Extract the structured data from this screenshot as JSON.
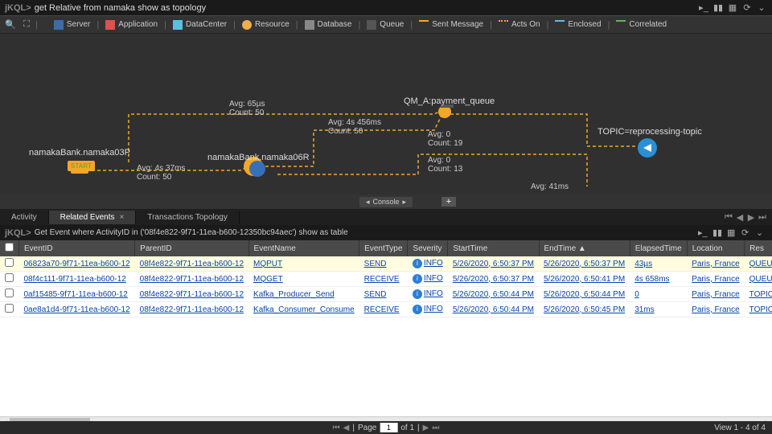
{
  "header": {
    "prompt": "jKQL>",
    "query": "get Relative from namaka show as topology"
  },
  "toolbar": {
    "search_icon": "🔍",
    "fullscreen_icon": "⛶",
    "legend": [
      {
        "icon": "server",
        "label": "Server"
      },
      {
        "icon": "app",
        "label": "Application"
      },
      {
        "icon": "dc",
        "label": "DataCenter"
      },
      {
        "icon": "res",
        "label": "Resource"
      },
      {
        "icon": "db",
        "label": "Database"
      },
      {
        "icon": "queue",
        "label": "Queue"
      },
      {
        "icon": "sent",
        "label": "Sent Message",
        "line": "dashed-orange"
      },
      {
        "icon": "acts",
        "label": "Acts On",
        "line": "dotted-orange"
      },
      {
        "icon": "encl",
        "label": "Enclosed",
        "line": "dashed-blue"
      },
      {
        "icon": "corr",
        "label": "Correlated",
        "line": "solid-green"
      }
    ]
  },
  "topology": {
    "nodes": {
      "n1": "namakaBank.namaka03P",
      "n2": "namakaBank.namaka06R",
      "n3": "QM_A:payment_queue",
      "n4": "TOPIC=reprocessing-topic"
    },
    "start": "START",
    "edges": [
      {
        "l1": "Avg: 4s 37ms",
        "l2": "Count: 50"
      },
      {
        "l1": "Avg: 65µs",
        "l2": "Count: 50"
      },
      {
        "l1": "Avg: 4s 456ms",
        "l2": "Count: 50"
      },
      {
        "l1": "Avg: 0",
        "l2": "Count: 19"
      },
      {
        "l1": "Avg: 0",
        "l2": "Count: 13"
      },
      {
        "l1": "Avg: 41ms",
        "l2": ""
      }
    ]
  },
  "console_label": "Console",
  "tabs": {
    "items": [
      "Activity",
      "Related Events",
      "Transactions Topology"
    ],
    "active": 1
  },
  "lower_header": {
    "prompt": "jKQL>",
    "query": "Get Event where ActivityID in ('08f4e822-9f71-11ea-b600-12350bc94aec') show as table"
  },
  "table": {
    "columns": [
      "",
      "EventID",
      "ParentID",
      "EventName",
      "EventType",
      "Severity",
      "StartTime",
      "EndTime ▲",
      "ElapsedTime",
      "Location",
      "Res"
    ],
    "rows": [
      {
        "highlight": true,
        "id": "06823a70-9f71-11ea-b600-12",
        "pid": "08f4e822-9f71-11ea-b600-12",
        "name": "MQPUT",
        "type": "SEND",
        "sev": "INFO",
        "start": "5/26/2020, 6:50:37 PM",
        "end": "5/26/2020, 6:50:37 PM",
        "elapsed": "43µs",
        "loc": "Paris, France",
        "res": "QUEUE=QM_A:pay"
      },
      {
        "highlight": false,
        "id": "08f4c111-9f71-11ea-b600-12",
        "pid": "08f4e822-9f71-11ea-b600-12",
        "name": "MQGET",
        "type": "RECEIVE",
        "sev": "INFO",
        "start": "5/26/2020, 6:50:37 PM",
        "end": "5/26/2020, 6:50:41 PM",
        "elapsed": "4s 658ms",
        "loc": "Paris, France",
        "res": "QUEUE=QM_A:pay"
      },
      {
        "highlight": false,
        "id": "0af15485-9f71-11ea-b600-12",
        "pid": "08f4e822-9f71-11ea-b600-12",
        "name": "Kafka_Producer_Send",
        "type": "SEND",
        "sev": "INFO",
        "start": "5/26/2020, 6:50:44 PM",
        "end": "5/26/2020, 6:50:44 PM",
        "elapsed": "0",
        "loc": "Paris, France",
        "res": "TOPIC=reprocessin"
      },
      {
        "highlight": false,
        "id": "0ae8a1d4-9f71-11ea-b600-12",
        "pid": "08f4e822-9f71-11ea-b600-12",
        "name": "Kafka_Consumer_Consume",
        "type": "RECEIVE",
        "sev": "INFO",
        "start": "5/26/2020, 6:50:44 PM",
        "end": "5/26/2020, 6:50:45 PM",
        "elapsed": "31ms",
        "loc": "Paris, France",
        "res": "TOPIC=reprocessin"
      }
    ]
  },
  "footer": {
    "page_label_pre": "Page",
    "page_value": "1",
    "page_label_post": "of 1",
    "view": "View 1 - 4 of 4"
  }
}
